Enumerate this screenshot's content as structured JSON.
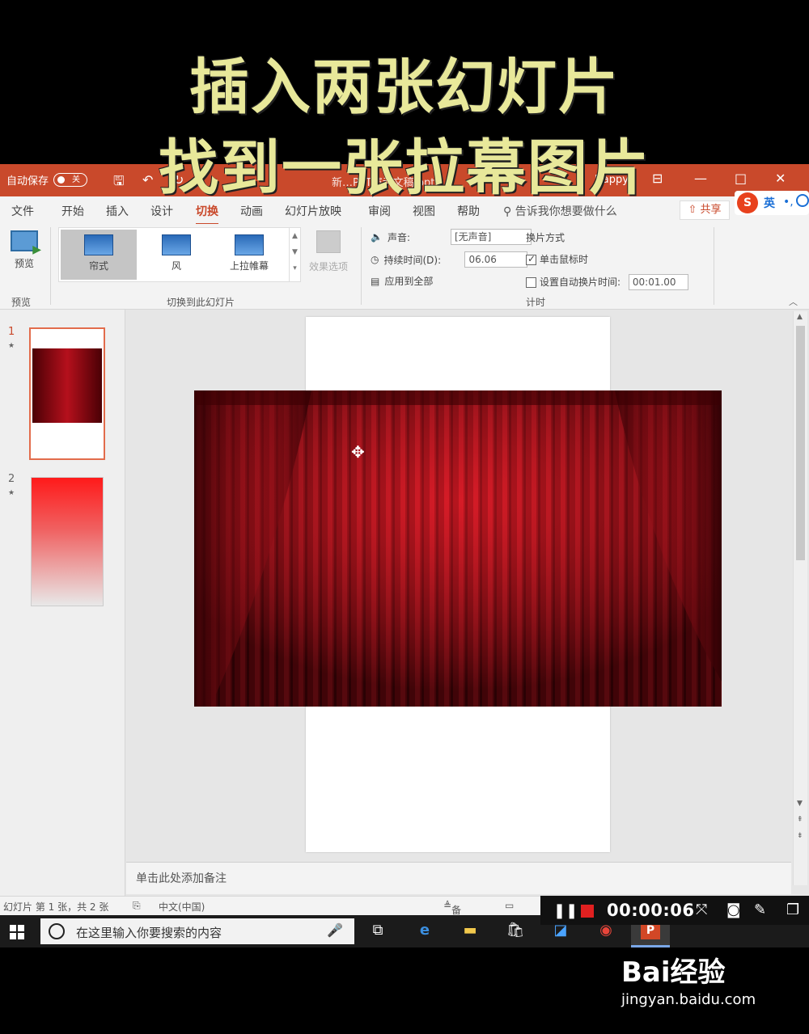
{
  "caption": {
    "line1": "插入两张幻灯片",
    "line2": "找到一张拉幕图片"
  },
  "titlebar": {
    "autosave_label": "自动保存",
    "autosave_state": "关",
    "doc_title": "新…PPT演示文稿.pptx",
    "user": "Happy",
    "minimize": "—",
    "maximize": "□",
    "close": "✕"
  },
  "tabs": [
    "文件",
    "开始",
    "插入",
    "设计",
    "切换",
    "动画",
    "幻灯片放映",
    "审阅",
    "视图",
    "帮助"
  ],
  "active_tab": "切换",
  "tell_me": "告诉我你想要做什么",
  "share_label": "共享",
  "sogou": {
    "s": "S",
    "en": "英",
    "dot": "•,"
  },
  "ribbon": {
    "preview_label": "预览",
    "preview_group": "预览",
    "transitions": [
      "帘式",
      "风",
      "上拉帷幕"
    ],
    "selected_transition": "帘式",
    "transition_group": "切换到此幻灯片",
    "effect_options": "效果选项",
    "sound_label": "声音:",
    "sound_value": "[无声音]",
    "duration_label": "持续时间(D):",
    "duration_value": "06.06",
    "apply_all": "应用到全部",
    "advance_title": "换片方式",
    "on_click": "单击鼠标时",
    "after_label": "设置自动换片时间:",
    "after_value": "00:01.00",
    "timing_group": "计时"
  },
  "thumbnails": [
    {
      "num": "1",
      "star": "★"
    },
    {
      "num": "2",
      "star": "★"
    }
  ],
  "notes_placeholder": "单击此处添加备注",
  "status": {
    "slide_info": "幻灯片 第 1 张，共 2 张",
    "language": "中文(中国)",
    "notes_btn": "备注"
  },
  "recording": {
    "time": "00:00:06"
  },
  "taskbar": {
    "search_placeholder": "在这里输入你要搜索的内容",
    "ppt_icon": "P"
  },
  "watermark": {
    "logo": "Bai经验",
    "url": "jingyan.baidu.com"
  },
  "colors": {
    "accent": "#c9492b",
    "caption": "#e8e89a",
    "curtain": "#a00a14"
  }
}
